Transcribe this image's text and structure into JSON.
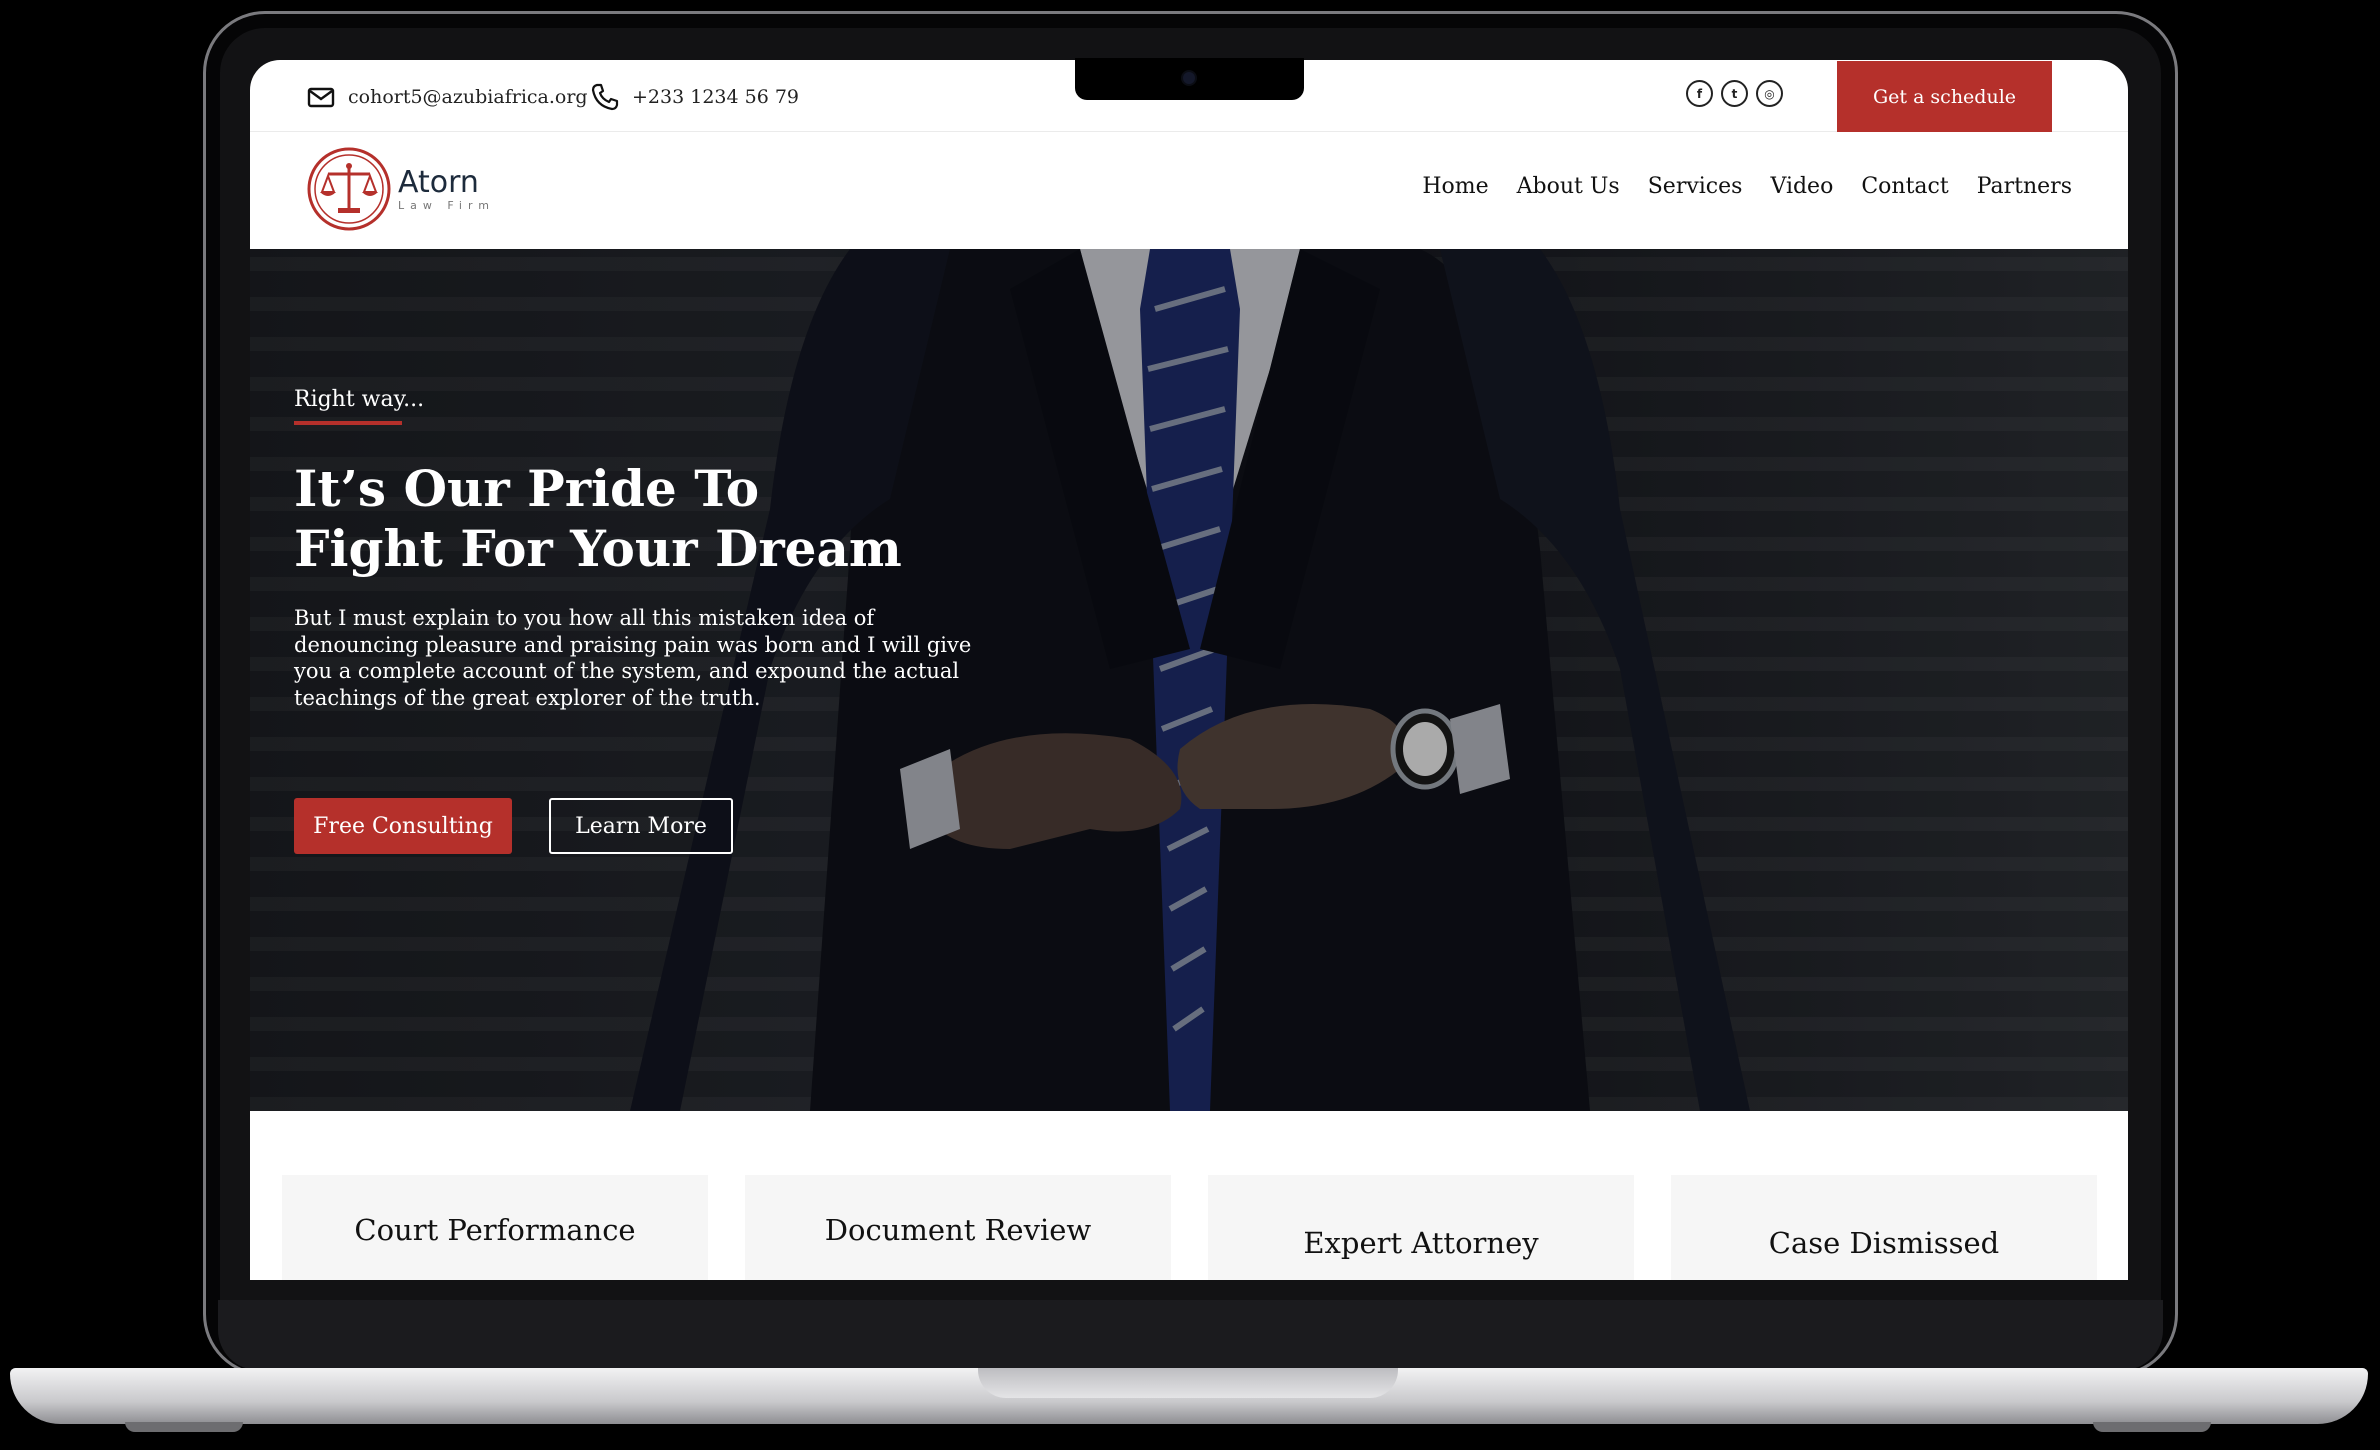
{
  "topbar": {
    "email": "cohort5@azubiafrica.org",
    "phone": "+233 1234 56 79",
    "socials": [
      {
        "name": "facebook-icon",
        "glyph": "f"
      },
      {
        "name": "twitter-icon",
        "glyph": "t"
      },
      {
        "name": "instagram-icon",
        "glyph": "◎"
      }
    ],
    "schedule_label": "Get a schedule"
  },
  "brand": {
    "name": "Atorn",
    "tagline": "Law Firm",
    "accent": "#b5302b"
  },
  "nav": {
    "items": [
      "Home",
      "About Us",
      "Services",
      "Video",
      "Contact",
      "Partners"
    ]
  },
  "hero": {
    "eyebrow": "Right way...",
    "title_line1": "It’s Our Pride To",
    "title_line2": "Fight For Your Dream",
    "body": "But I must explain to you how all this mistaken idea of denouncing pleasure and praising pain was born and I will give you a complete account of the system, and expound the actual teachings of the great explorer of the truth.",
    "primary_button": "Free Consulting",
    "secondary_button": "Learn More"
  },
  "features": [
    "Court Performance",
    "Document Review",
    "Expert Attorney",
    "Case Dismissed"
  ]
}
